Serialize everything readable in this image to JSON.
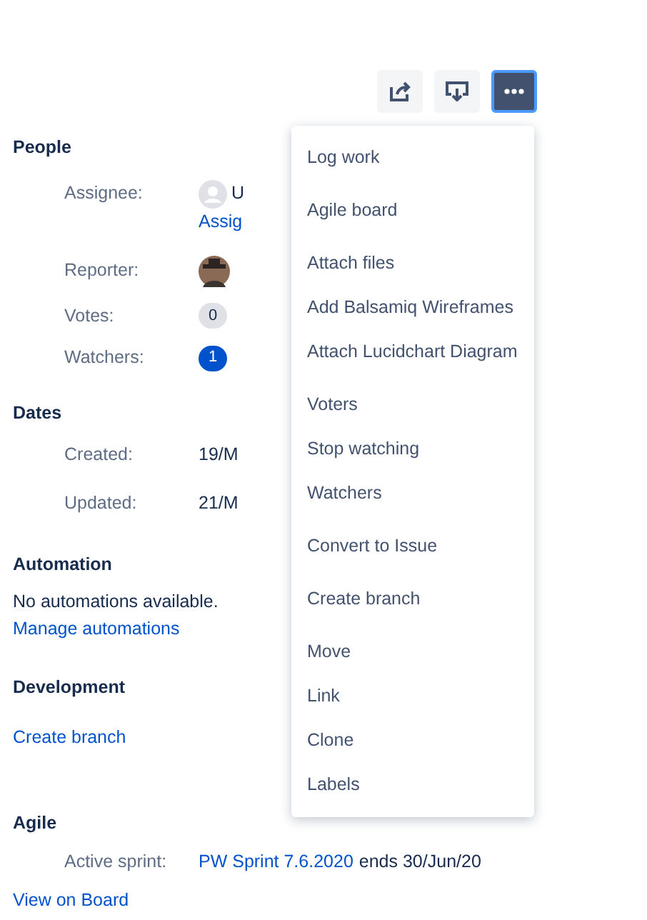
{
  "toolbar": [
    {
      "kind": "share",
      "selected": false
    },
    {
      "kind": "export",
      "selected": false
    },
    {
      "kind": "more",
      "selected": true
    }
  ],
  "people": {
    "heading": "People",
    "assignee": {
      "label": "Assignee:",
      "name": "U",
      "link": "Assig"
    },
    "reporter": {
      "label": "Reporter:"
    },
    "votes": {
      "label": "Votes:",
      "count": "0",
      "active": false
    },
    "watchers": {
      "label": "Watchers:",
      "count": "1",
      "active": true
    }
  },
  "dates": {
    "heading": "Dates",
    "rows": [
      {
        "label": "Created:",
        "value": "19/M"
      },
      {
        "label": "Updated:",
        "value": "21/M"
      }
    ]
  },
  "automation": {
    "heading": "Automation",
    "text": "No automations available.",
    "link": "Manage automations"
  },
  "development": {
    "heading": "Development",
    "link": "Create branch"
  },
  "agile": {
    "heading": "Agile",
    "label": "Active sprint:",
    "sprint_link": "PW Sprint 7.6.2020",
    "sprint_end": "ends 30/Jun/20",
    "link": "View on Board"
  },
  "menu": {
    "groups": [
      [
        "Log work"
      ],
      [
        "Agile board"
      ],
      [
        "Attach files",
        "Add Balsamiq Wireframes",
        "Attach Lucidchart Diagram"
      ],
      [
        "Voters",
        "Stop watching",
        "Watchers"
      ],
      [
        "Convert to Issue"
      ],
      [
        "Create branch"
      ],
      [
        "Move",
        "Link",
        "Clone",
        "Labels"
      ]
    ]
  }
}
